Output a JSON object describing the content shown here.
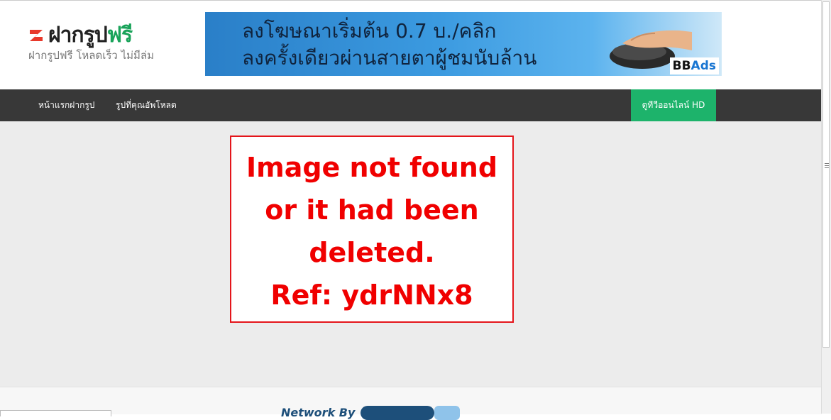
{
  "header": {
    "logo": {
      "name_black": "ฝากรูป",
      "name_green": "ฟรี",
      "tagline": "ฝากรูปฟรี โหลดเร็ว ไม่มีล่ม"
    },
    "banner": {
      "line1": "ลงโฆษณาเริ่มต้น  0.7 บ./คลิก",
      "line2": "ลงครั้งเดียวผ่านสายตาผู้ชมนับล้าน",
      "brand_bb": "BB",
      "brand_ads": "Ads"
    }
  },
  "nav": {
    "items": [
      {
        "label": "หน้าแรกฝากรูป"
      },
      {
        "label": "รูปที่คุณอัพโหลด"
      }
    ],
    "cta_label": "ดูทีวีออนไลน์ HD"
  },
  "notice": {
    "lines": [
      "Image not found",
      "or it had been",
      "deleted.",
      "Ref: ydrNNx8"
    ]
  },
  "footer": {
    "network_label": "Network By"
  },
  "colors": {
    "nav_bg": "#383838",
    "cta_bg": "#1db36b",
    "notice_red": "#f00000",
    "brand_green": "#1aa35a"
  }
}
